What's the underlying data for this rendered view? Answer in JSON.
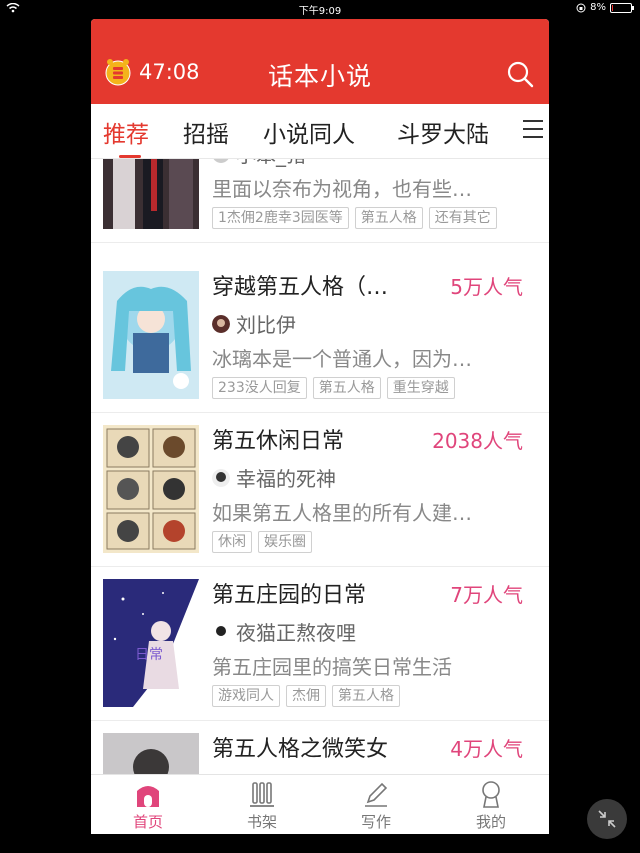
{
  "status_bar": {
    "time": "下午9:09",
    "battery": "8%",
    "battery_level": 0.08
  },
  "header": {
    "timer": "47:08",
    "title": "话本小说",
    "icons": {
      "timer": "alarm-coin-icon",
      "search": "search-icon"
    }
  },
  "tabs": [
    {
      "label": "推荐",
      "active": true
    },
    {
      "label": "招摇"
    },
    {
      "label": "小说同人"
    },
    {
      "label": "斗罗大陆"
    }
  ],
  "stories": [
    {
      "title": "",
      "popularity": "",
      "author": "小笨_猪",
      "description": "里面以奈布为视角，也有些…",
      "tags": [
        "1杰佣2鹿幸3园医等",
        "第五人格",
        "还有其它"
      ]
    },
    {
      "title": "穿越第五人格（…",
      "popularity": "5万人气",
      "author": "刘比伊",
      "description": "冰璃本是一个普通人，因为…",
      "tags": [
        "233没人回复",
        "第五人格",
        "重生穿越"
      ]
    },
    {
      "title": "第五休闲日常",
      "popularity": "2038人气",
      "author": "幸福的死神",
      "description": "如果第五人格里的所有人建…",
      "tags": [
        "休闲",
        "娱乐圈"
      ]
    },
    {
      "title": "第五庄园的日常",
      "popularity": "7万人气",
      "author": "夜猫正熬夜哩",
      "description": "第五庄园里的搞笑日常生活",
      "tags": [
        "游戏同人",
        "杰佣",
        "第五人格"
      ]
    },
    {
      "title": "第五人格之微笑女",
      "popularity": "4万人气",
      "author": "",
      "description": "",
      "tags": []
    }
  ],
  "bottom_nav": [
    {
      "label": "首页",
      "icon": "home-icon",
      "active": true
    },
    {
      "label": "书架",
      "icon": "bookshelf-icon"
    },
    {
      "label": "写作",
      "icon": "pen-icon"
    },
    {
      "label": "我的",
      "icon": "profile-icon"
    }
  ],
  "colors": {
    "brand": "#e4392f",
    "accent": "#e0457b"
  }
}
